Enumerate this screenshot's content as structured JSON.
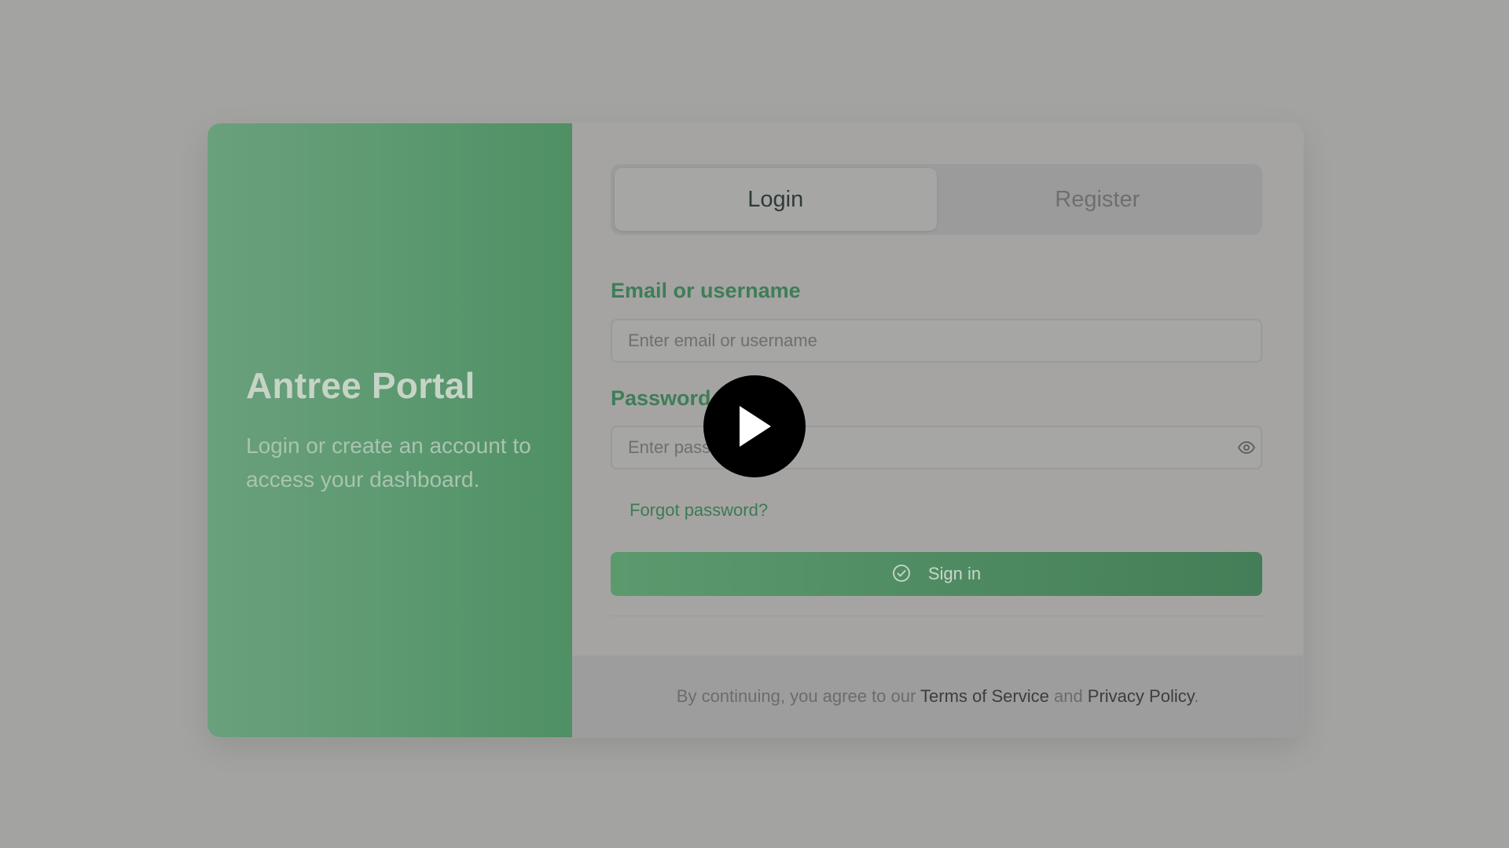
{
  "hero": {
    "title": "Antree Portal",
    "subtitle": "Login or create an account to access your dashboard."
  },
  "tabs": [
    {
      "label": "Login",
      "active": true
    },
    {
      "label": "Register",
      "active": false
    }
  ],
  "form": {
    "email_label": "Email or username",
    "email_placeholder": "Enter email or username",
    "password_label": "Password",
    "password_placeholder": "Enter password",
    "forgot_link": "Forgot password?",
    "signin_label": "Sign in"
  },
  "footer": {
    "prefix": "By continuing, you agree to our ",
    "terms_link": "Terms of Service",
    "middle": " and ",
    "privacy_link": "Privacy Policy",
    "suffix": "."
  },
  "icons": {
    "password_toggle": "eye-icon",
    "signin": "check-circle-icon",
    "video": "play-icon"
  },
  "colors": {
    "accent": "#4f9064",
    "label": "#3f7d57"
  }
}
